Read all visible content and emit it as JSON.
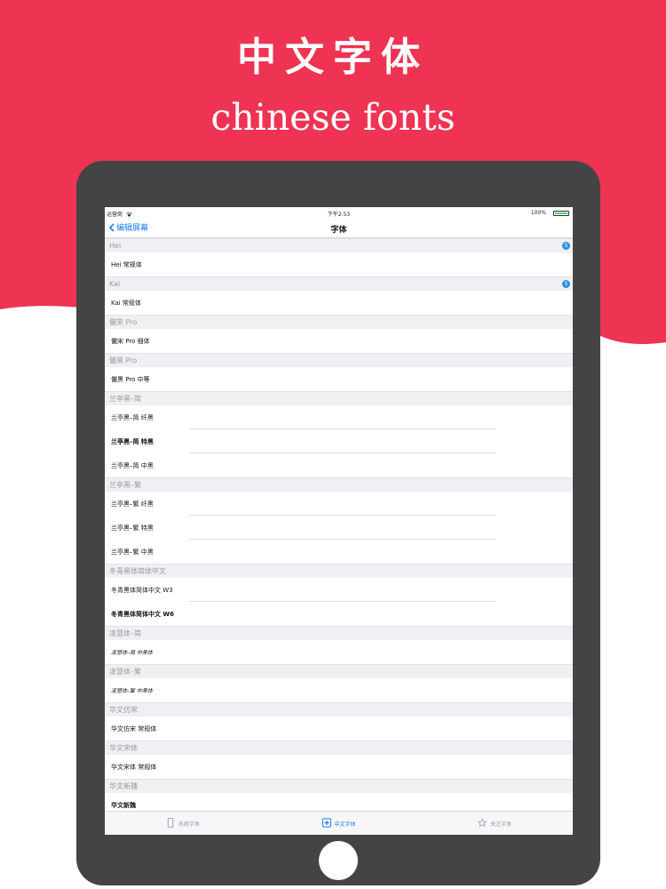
{
  "colors": {
    "brand_red": "#ee3353",
    "device": "#444445",
    "accent_blue": "#1a7cf5"
  },
  "promo": {
    "title_cn": "中文字体",
    "title_en": "chinese fonts"
  },
  "status_bar": {
    "carrier": "运营商",
    "time": "下午2:53",
    "battery": "100%",
    "battery_level": 1.0
  },
  "nav": {
    "back_label": "编辑屏幕",
    "title": "字体"
  },
  "sections": [
    {
      "header": "Hei",
      "badge": "5",
      "rows": [
        {
          "label": "Hei 常规体"
        }
      ]
    },
    {
      "header": "Kai",
      "badge": "5",
      "rows": [
        {
          "label": "Kai 常规体"
        }
      ]
    },
    {
      "header": "儷宋 Pro",
      "rows": [
        {
          "label": "儷宋 Pro 细体"
        }
      ]
    },
    {
      "header": "儷黑 Pro",
      "rows": [
        {
          "label": "儷黑 Pro 中等"
        }
      ]
    },
    {
      "header": "兰亭黑–简",
      "rows": [
        {
          "label": "兰亭黑–简 纤黑"
        },
        {
          "label": "兰亭黑–简 特黑",
          "style": "bold"
        },
        {
          "label": "兰亭黑–简 中黑"
        }
      ]
    },
    {
      "header": "兰亭黑–繁",
      "rows": [
        {
          "label": "兰亭黑–繁 纤黑"
        },
        {
          "label": "兰亭黑–繁 特黑"
        },
        {
          "label": "兰亭黑–繁 中黑"
        }
      ]
    },
    {
      "header": "冬青黑体简体中文",
      "rows": [
        {
          "label": "冬青黑体简体中文 W3"
        },
        {
          "label": "冬青黑体简体中文 W6",
          "style": "bold"
        }
      ]
    },
    {
      "header": "凌慧体–简",
      "rows": [
        {
          "label": "凌慧体–简 中黑体",
          "style": "script"
        }
      ]
    },
    {
      "header": "凌慧体–繁",
      "rows": [
        {
          "label": "凌慧体–繁 中黑体",
          "style": "script"
        }
      ]
    },
    {
      "header": "华文仿宋",
      "rows": [
        {
          "label": "华文仿宋 常规体"
        }
      ]
    },
    {
      "header": "华文宋体",
      "rows": [
        {
          "label": "华文宋体 常规体"
        }
      ]
    },
    {
      "header": "华文新魏",
      "rows": [
        {
          "label": "华文新魏",
          "style": "bold"
        }
      ]
    }
  ],
  "tabs": [
    {
      "label": "系统字体",
      "icon": "phone-icon",
      "active": false
    },
    {
      "label": "中文字体",
      "icon": "add-square-icon",
      "active": true
    },
    {
      "label": "关注字体",
      "icon": "star-icon",
      "active": false
    }
  ]
}
